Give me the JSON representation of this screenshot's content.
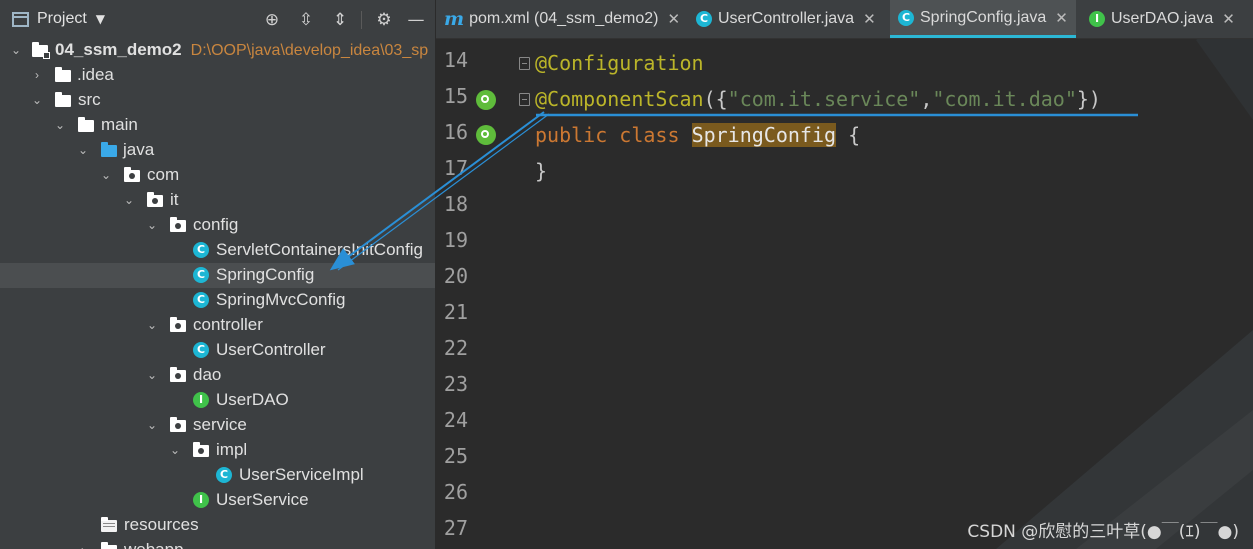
{
  "project_panel": {
    "title": "Project",
    "tree": [
      {
        "label": "04_ssm_demo2",
        "path": "D:\\OOP\\java\\develop_idea\\03_sp",
        "icon": "module-folder-icon",
        "expanded": true
      },
      {
        "label": ".idea",
        "icon": "folder-icon",
        "expanded": false
      },
      {
        "label": "src",
        "icon": "folder-icon",
        "expanded": true
      },
      {
        "label": "main",
        "icon": "folder-icon",
        "expanded": true
      },
      {
        "label": "java",
        "icon": "source-folder-icon",
        "expanded": true
      },
      {
        "label": "com",
        "icon": "package-icon",
        "expanded": true
      },
      {
        "label": "it",
        "icon": "package-icon",
        "expanded": true
      },
      {
        "label": "config",
        "icon": "package-icon",
        "expanded": true
      },
      {
        "label": "ServletContainersInitConfig",
        "icon": "class-icon"
      },
      {
        "label": "SpringConfig",
        "icon": "class-icon",
        "selected": true
      },
      {
        "label": "SpringMvcConfig",
        "icon": "class-icon"
      },
      {
        "label": "controller",
        "icon": "package-icon",
        "expanded": true
      },
      {
        "label": "UserController",
        "icon": "class-icon"
      },
      {
        "label": "dao",
        "icon": "package-icon",
        "expanded": true
      },
      {
        "label": "UserDAO",
        "icon": "interface-icon"
      },
      {
        "label": "service",
        "icon": "package-icon",
        "expanded": true
      },
      {
        "label": "impl",
        "icon": "package-icon",
        "expanded": true
      },
      {
        "label": "UserServiceImpl",
        "icon": "class-icon"
      },
      {
        "label": "UserService",
        "icon": "interface-icon"
      },
      {
        "label": "resources",
        "icon": "resources-folder-icon"
      },
      {
        "label": "webapp",
        "icon": "folder-icon"
      }
    ]
  },
  "tabs": [
    {
      "label": "pom.xml (04_ssm_demo2)",
      "icon": "maven-icon",
      "icon_glyph": "m",
      "close": "✕"
    },
    {
      "label": "UserController.java",
      "icon": "class-icon",
      "icon_glyph": "C",
      "close": "✕"
    },
    {
      "label": "SpringConfig.java",
      "icon": "class-icon",
      "icon_glyph": "C",
      "close": "✕",
      "active": true
    },
    {
      "label": "UserDAO.java",
      "icon": "interface-icon",
      "icon_glyph": "I",
      "close": "✕"
    }
  ],
  "gutter": {
    "line_numbers": [
      "14",
      "15",
      "16",
      "17",
      "18",
      "19",
      "20",
      "21",
      "22",
      "23",
      "24",
      "25",
      "26",
      "27"
    ]
  },
  "code": {
    "line14": {
      "annotation": "@Configuration"
    },
    "line15": {
      "annotation": "@ComponentScan",
      "open": "({",
      "str1": "\"com.it.service\"",
      "comma": ",",
      "str2": "\"com.it.dao\"",
      "close": "})"
    },
    "line16": {
      "kw_public": "public",
      "kw_class": "class",
      "class_name": "SpringConfig",
      "brace": " {"
    },
    "line17": {
      "brace": "}"
    }
  },
  "watermark": "CSDN @欣慰的三叶草(●￣(ｴ)￣●)",
  "colors": {
    "annotation": "#bbb529",
    "string": "#6a8759",
    "keyword": "#cc7832",
    "accent": "#2cb8d6",
    "arrow": "#2a8fd6"
  }
}
